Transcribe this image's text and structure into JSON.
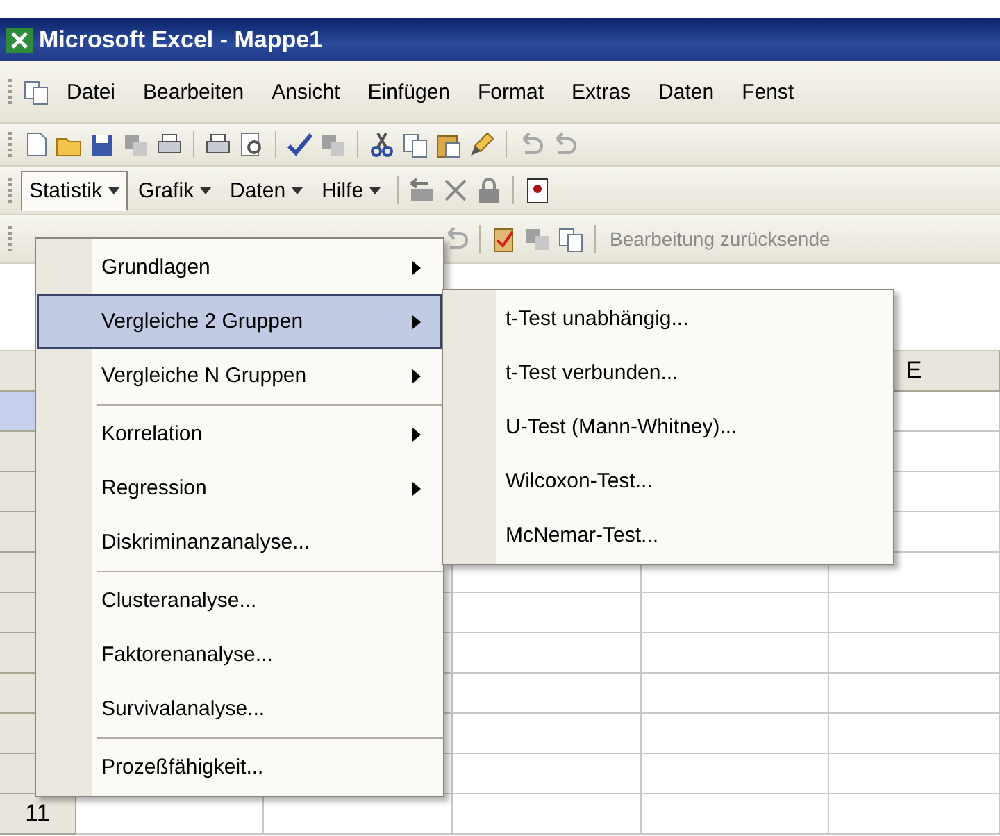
{
  "window": {
    "title": "Microsoft Excel - Mappe1"
  },
  "menubar": [
    "Datei",
    "Bearbeiten",
    "Ansicht",
    "Einfügen",
    "Format",
    "Extras",
    "Daten",
    "Fenst"
  ],
  "addin_menubar": [
    {
      "label": "Statistik",
      "selected": true
    },
    {
      "label": "Grafik",
      "selected": false
    },
    {
      "label": "Daten",
      "selected": false
    },
    {
      "label": "Hilfe",
      "selected": false
    }
  ],
  "review_toolbar": {
    "label": "Bearbeitung zurücksende"
  },
  "sheet": {
    "column_header": "E",
    "row_header": "11"
  },
  "menu": {
    "items": [
      {
        "label": "Grundlagen",
        "kind": "submenu",
        "selected": false
      },
      {
        "label": "Vergleiche 2 Gruppen",
        "kind": "submenu",
        "selected": true
      },
      {
        "label": "Vergleiche N Gruppen",
        "kind": "submenu",
        "selected": false
      },
      {
        "kind": "separator"
      },
      {
        "label": "Korrelation",
        "kind": "submenu",
        "selected": false
      },
      {
        "label": "Regression",
        "kind": "submenu",
        "selected": false
      },
      {
        "label": "Diskriminanzanalyse...",
        "kind": "command",
        "selected": false
      },
      {
        "kind": "separator"
      },
      {
        "label": "Clusteranalyse...",
        "kind": "command",
        "selected": false
      },
      {
        "label": "Faktorenanalyse...",
        "kind": "command",
        "selected": false
      },
      {
        "label": "Survivalanalyse...",
        "kind": "command",
        "selected": false
      },
      {
        "kind": "separator"
      },
      {
        "label": "Prozeßfähigkeit...",
        "kind": "command",
        "selected": false
      }
    ]
  },
  "submenu": {
    "items": [
      {
        "label": "t-Test unabhängig...",
        "kind": "command",
        "selected": false
      },
      {
        "label": "t-Test verbunden...",
        "kind": "command",
        "selected": false
      },
      {
        "label": "U-Test (Mann-Whitney)...",
        "kind": "command",
        "selected": false
      },
      {
        "label": "Wilcoxon-Test...",
        "kind": "command",
        "selected": false
      },
      {
        "label": "McNemar-Test...",
        "kind": "command",
        "selected": false
      }
    ]
  }
}
